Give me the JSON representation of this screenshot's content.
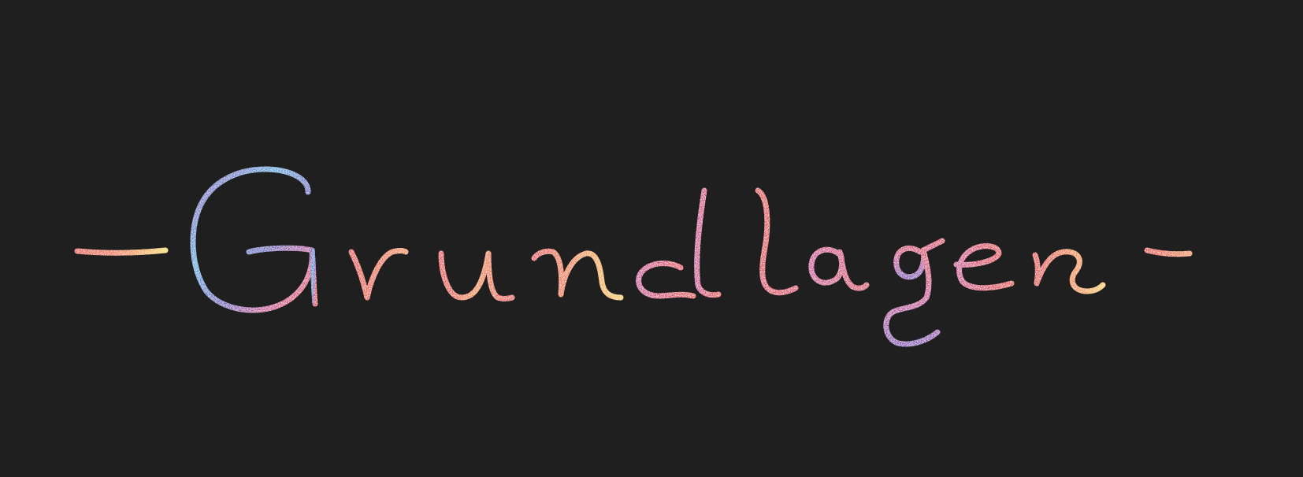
{
  "background_color": "#1f1f1f",
  "lettering": {
    "word": "Grundlagen",
    "prefix": "-",
    "suffix": "-",
    "style": "handwritten glitter gradient",
    "colors": {
      "yellow": "#f6c53a",
      "orange": "#f0862a",
      "red": "#e2302d",
      "crimson": "#d92a52",
      "magenta": "#c8308f",
      "purple": "#7c3ab0",
      "blue": "#3aa2d8"
    }
  }
}
